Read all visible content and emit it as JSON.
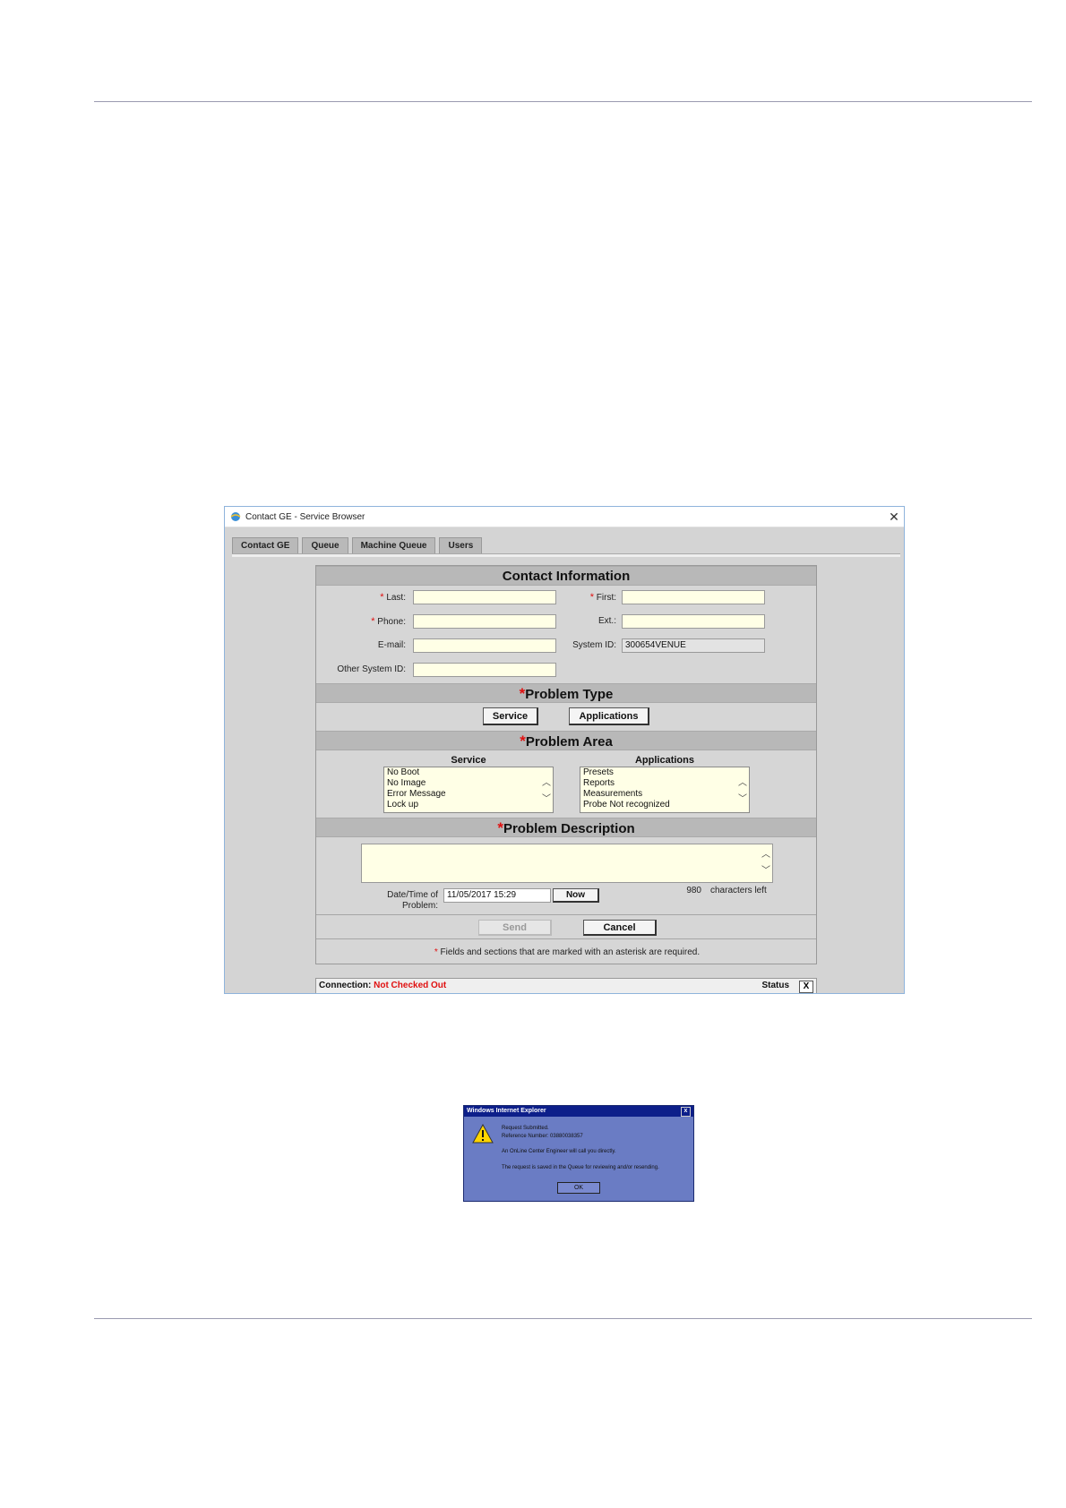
{
  "window": {
    "title": "Contact GE - Service Browser",
    "close_glyph": "✕",
    "icon": "ie-globe-icon"
  },
  "tabs": [
    {
      "label": "Contact GE"
    },
    {
      "label": "Queue"
    },
    {
      "label": "Machine Queue"
    },
    {
      "label": "Users"
    }
  ],
  "contact": {
    "header": "Contact Information",
    "last_label": "Last:",
    "first_label": "First:",
    "phone_label": "Phone:",
    "ext_label": "Ext.:",
    "email_label": "E-mail:",
    "system_id_label": "System ID:",
    "system_id_value": "300654VENUE",
    "other_system_id_label": "Other System ID:"
  },
  "required_mark": "*",
  "problem_type": {
    "header": "Problem Type",
    "service_btn": "Service",
    "applications_btn": "Applications"
  },
  "problem_area": {
    "header": "Problem Area",
    "service_head": "Service",
    "service_items": [
      "No Boot",
      "No Image",
      "Error Message",
      "Lock up"
    ],
    "applications_head": "Applications",
    "applications_items": [
      "Presets",
      "Reports",
      "Measurements",
      "Probe Not recognized"
    ]
  },
  "problem_description": {
    "header": "Problem Description",
    "chars_count": "980",
    "chars_left_label": "characters left",
    "datetime_label_1": "Date/Time of",
    "datetime_label_2": "Problem:",
    "datetime_value": "11/05/2017 15:29",
    "now_btn": "Now"
  },
  "actions": {
    "send": "Send",
    "cancel": "Cancel",
    "note": "Fields and sections that are marked with an asterisk are required."
  },
  "status": {
    "connection_label": "Connection:",
    "connection_value": "Not Checked Out",
    "status_label": "Status",
    "close": "X"
  },
  "dialog": {
    "title": "Windows Internet Explorer",
    "close": "x",
    "line1": "Request Submitted.",
    "line2": "Reference Number: 03880038357",
    "line3": "An OnLine Center Engineer will call you directly.",
    "line4": "The request is saved in the Queue for reviewing and/or resending.",
    "ok": "OK"
  },
  "colors": {
    "required": "#e01010",
    "input_bg": "#ffffe6",
    "dialog_bg": "#6a7cc4",
    "dialog_title": "#0d1f8a"
  }
}
